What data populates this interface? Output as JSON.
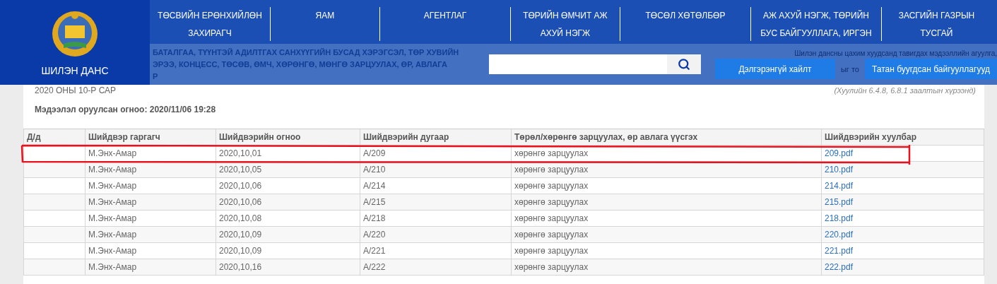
{
  "header": {
    "logo_text": "ШИЛЭН ДАНС",
    "nav": [
      {
        "label": "ТӨСВИЙН ЕРӨНХИЙЛӨН ЗАХИРАГЧ"
      },
      {
        "label": "ЯАМ"
      },
      {
        "label": "АГЕНТЛАГ"
      },
      {
        "label": "ТӨРИЙН ӨМЧИТ АЖ АХУЙ НЭГЖ"
      },
      {
        "label": "ТӨСӨЛ ХӨТӨЛБӨР"
      },
      {
        "label": "АЖ АХУЙ НЭГЖ, ТӨРИЙН БУС БАЙГУУЛЛАГА, ИРГЭН"
      },
      {
        "label": "ЗАСГИЙН ГАЗРЫН ТУСГАЙ"
      }
    ],
    "buttons": [
      "Дэлгэрэнгүй хайлт",
      "Татан буугдсан байгууллагууд"
    ]
  },
  "page_title_lines": [
    "БАТАЛГАА, ТҮҮНТЭЙ АДИЛТГАХ САНХҮҮГИЙН БУСАД ХЭРЭГСЭЛ, ТӨР ХУВИЙН",
    "ЭРЭЭ, КОНЦЕСС, ТӨСӨВ, ӨМЧ, ХӨРӨНГӨ, МӨНГӨ ЗАРЦУУЛАХ, ӨР, АВЛАГА",
    "Р"
  ],
  "notice": "Шилэн дансны цахим хуудсанд тавигдах мэдээллийн агуулга,",
  "notice_fragment": "ыг то",
  "law_note": "(Хуулийн 6.4.8, 6.8.1 заалтын хүрээнд)",
  "period": "2020 ОНЫ 10-Р САР",
  "updated": "Мэдээлэл оруулсан огноо: 2020/11/06 19:28",
  "table": {
    "columns": [
      "Д/д",
      "Шийдвэр гаргагч",
      "Шийдвэрийн огноо",
      "Шийдвэрийн дугаар",
      "Төрөл/хөрөнгө зарцуулах, өр авлага үүсгэх",
      "Шийдвэрийн хуулбар"
    ],
    "rows": [
      {
        "cells": [
          "",
          "М.Энх-Амар",
          "2020,10,01",
          "А/209",
          "хөрөнгө зарцуулах"
        ],
        "file": "209.pdf",
        "marked": true
      },
      {
        "cells": [
          "",
          "М.Энх-Амар",
          "2020,10,05",
          "А/210",
          "хөрөнгө зарцуулах"
        ],
        "file": "210.pdf",
        "marked": false
      },
      {
        "cells": [
          "",
          "М.Энх-Амар",
          "2020,10,06",
          "А/214",
          "хөрөнгө зарцуулах"
        ],
        "file": "214.pdf",
        "marked": false
      },
      {
        "cells": [
          "",
          "М.Энх-Амар",
          "2020,10,06",
          "А/215",
          "хөрөнгө зарцуулах"
        ],
        "file": "215.pdf",
        "marked": false
      },
      {
        "cells": [
          "",
          "М.Энх-Амар",
          "2020,10,08",
          "А/218",
          "хөрөнгө зарцуулах"
        ],
        "file": "218.pdf",
        "marked": false
      },
      {
        "cells": [
          "",
          "М.Энх-Амар",
          "2020,10,09",
          "А/220",
          "хөрөнгө зарцуулах"
        ],
        "file": "220.pdf",
        "marked": false
      },
      {
        "cells": [
          "",
          "М.Энх-Амар",
          "2020,10,09",
          "А/221",
          "хөрөнгө зарцуулах"
        ],
        "file": "221.pdf",
        "marked": false
      },
      {
        "cells": [
          "",
          "М.Энх-Амар",
          "2020,10,16",
          "А/222",
          "хөрөнгө зарцуулах"
        ],
        "file": "222.pdf",
        "marked": false
      }
    ]
  }
}
